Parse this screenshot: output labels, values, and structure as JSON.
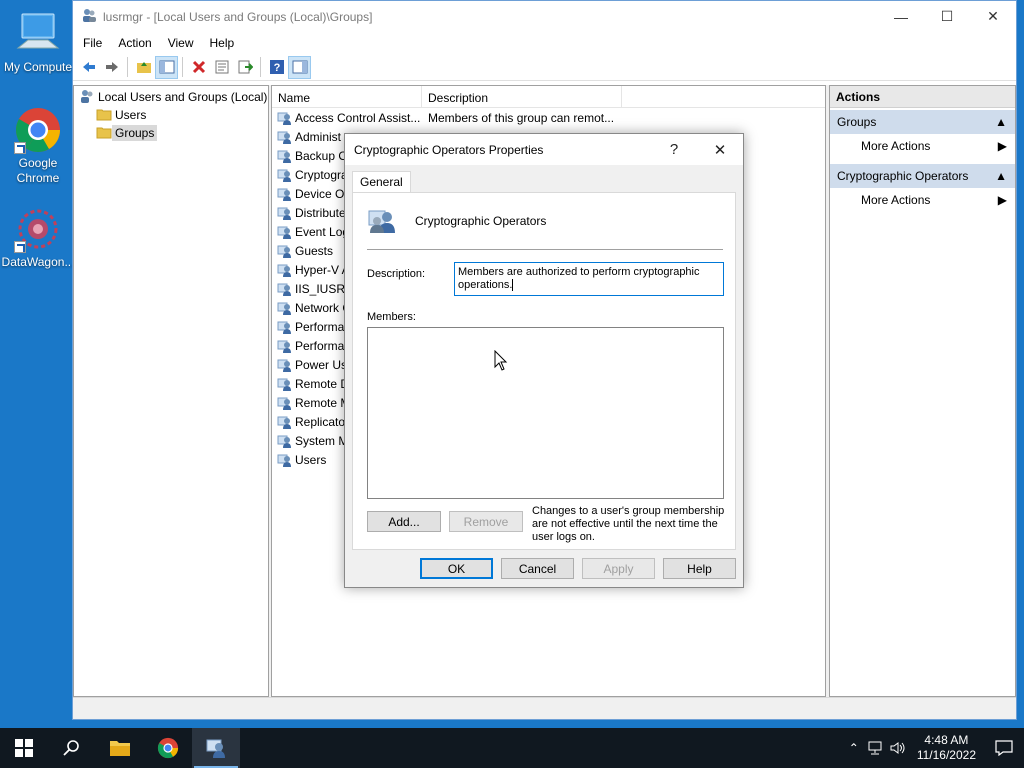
{
  "desktop": {
    "icons": [
      {
        "label": "My Compute"
      },
      {
        "label": "Google Chrome"
      },
      {
        "label": "DataWagon..."
      }
    ]
  },
  "window": {
    "title": "lusrmgr - [Local Users and Groups (Local)\\Groups]",
    "menu": [
      "File",
      "Action",
      "View",
      "Help"
    ]
  },
  "tree": {
    "root": "Local Users and Groups (Local)",
    "children": [
      "Users",
      "Groups"
    ],
    "selected": "Groups"
  },
  "list": {
    "columns": [
      "Name",
      "Description"
    ],
    "rows": [
      {
        "name": "Access Control Assist...",
        "desc": "Members of this group can remot..."
      },
      {
        "name": "Administ",
        "desc": ""
      },
      {
        "name": "Backup O",
        "desc": ""
      },
      {
        "name": "Cryptogra",
        "desc": ""
      },
      {
        "name": "Device Ow",
        "desc": ""
      },
      {
        "name": "Distribute",
        "desc": ""
      },
      {
        "name": "Event Log",
        "desc": ""
      },
      {
        "name": "Guests",
        "desc": ""
      },
      {
        "name": "Hyper-V A",
        "desc": ""
      },
      {
        "name": "IIS_IUSRS",
        "desc": ""
      },
      {
        "name": "Network C",
        "desc": ""
      },
      {
        "name": "Performa",
        "desc": ""
      },
      {
        "name": "Performa",
        "desc": ""
      },
      {
        "name": "Power Use",
        "desc": ""
      },
      {
        "name": "Remote D",
        "desc": ""
      },
      {
        "name": "Remote M",
        "desc": ""
      },
      {
        "name": "Replicato",
        "desc": ""
      },
      {
        "name": "System M",
        "desc": ""
      },
      {
        "name": "Users",
        "desc": ""
      }
    ]
  },
  "actions": {
    "header": "Actions",
    "sections": [
      {
        "title": "Groups",
        "item": "More Actions"
      },
      {
        "title": "Cryptographic Operators",
        "item": "More Actions"
      }
    ]
  },
  "dialog": {
    "title": "Cryptographic Operators Properties",
    "help_glyph": "?",
    "tab": "General",
    "group_name": "Cryptographic Operators",
    "description_label": "Description:",
    "description_value": "Members are authorized to perform cryptographic operations.",
    "members_label": "Members:",
    "add": "Add...",
    "remove": "Remove",
    "note": "Changes to a user's group membership are not effective until the next time the user logs on.",
    "ok": "OK",
    "cancel": "Cancel",
    "apply": "Apply",
    "help": "Help"
  },
  "taskbar": {
    "time": "4:48 AM",
    "date": "11/16/2022"
  },
  "colors": {
    "desktop": "#1a78c8",
    "accent": "#0078d7",
    "action_section": "#cfdcec"
  }
}
